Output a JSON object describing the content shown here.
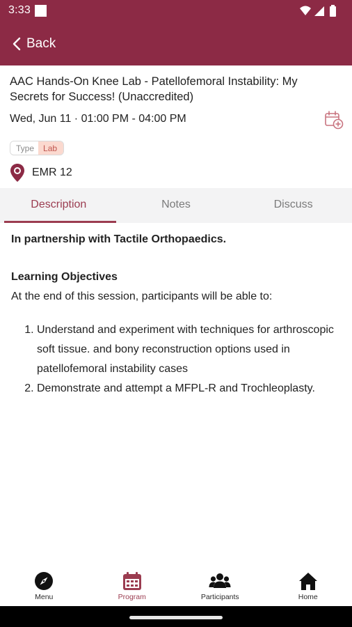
{
  "status_bar": {
    "time": "3:33"
  },
  "app_bar": {
    "back_label": "Back"
  },
  "session": {
    "title": "AAC Hands-On Knee Lab - Patellofemoral Instability: My Secrets for Success! (Unaccredited)",
    "datetime": "Wed, Jun 11 · 01:00 PM - 04:00 PM",
    "tag_key": "Type",
    "tag_value": "Lab",
    "location": "EMR 12"
  },
  "tabs": [
    {
      "label": "Description",
      "active": true
    },
    {
      "label": "Notes",
      "active": false
    },
    {
      "label": "Discuss",
      "active": false
    }
  ],
  "description": {
    "partnership": "In partnership with Tactile Orthopaedics.",
    "objectives_heading": "Learning Objectives",
    "objectives_intro": "At the end of this session, participants will be able to:",
    "objectives": [
      "Understand and experiment with techniques for arthroscopic soft tissue. and bony reconstruction options used in patellofemoral instability cases",
      "Demonstrate and attempt a MFPL-R and Trochleoplasty."
    ]
  },
  "bottom_nav": [
    {
      "label": "Menu",
      "icon": "compass-icon",
      "active": false
    },
    {
      "label": "Program",
      "icon": "calendar-icon",
      "active": true
    },
    {
      "label": "Participants",
      "icon": "people-icon",
      "active": false
    },
    {
      "label": "Home",
      "icon": "home-icon",
      "active": false
    }
  ],
  "colors": {
    "brand": "#8c2a45",
    "accent": "#9b3c50",
    "tag_bg": "#fbd9cf"
  }
}
